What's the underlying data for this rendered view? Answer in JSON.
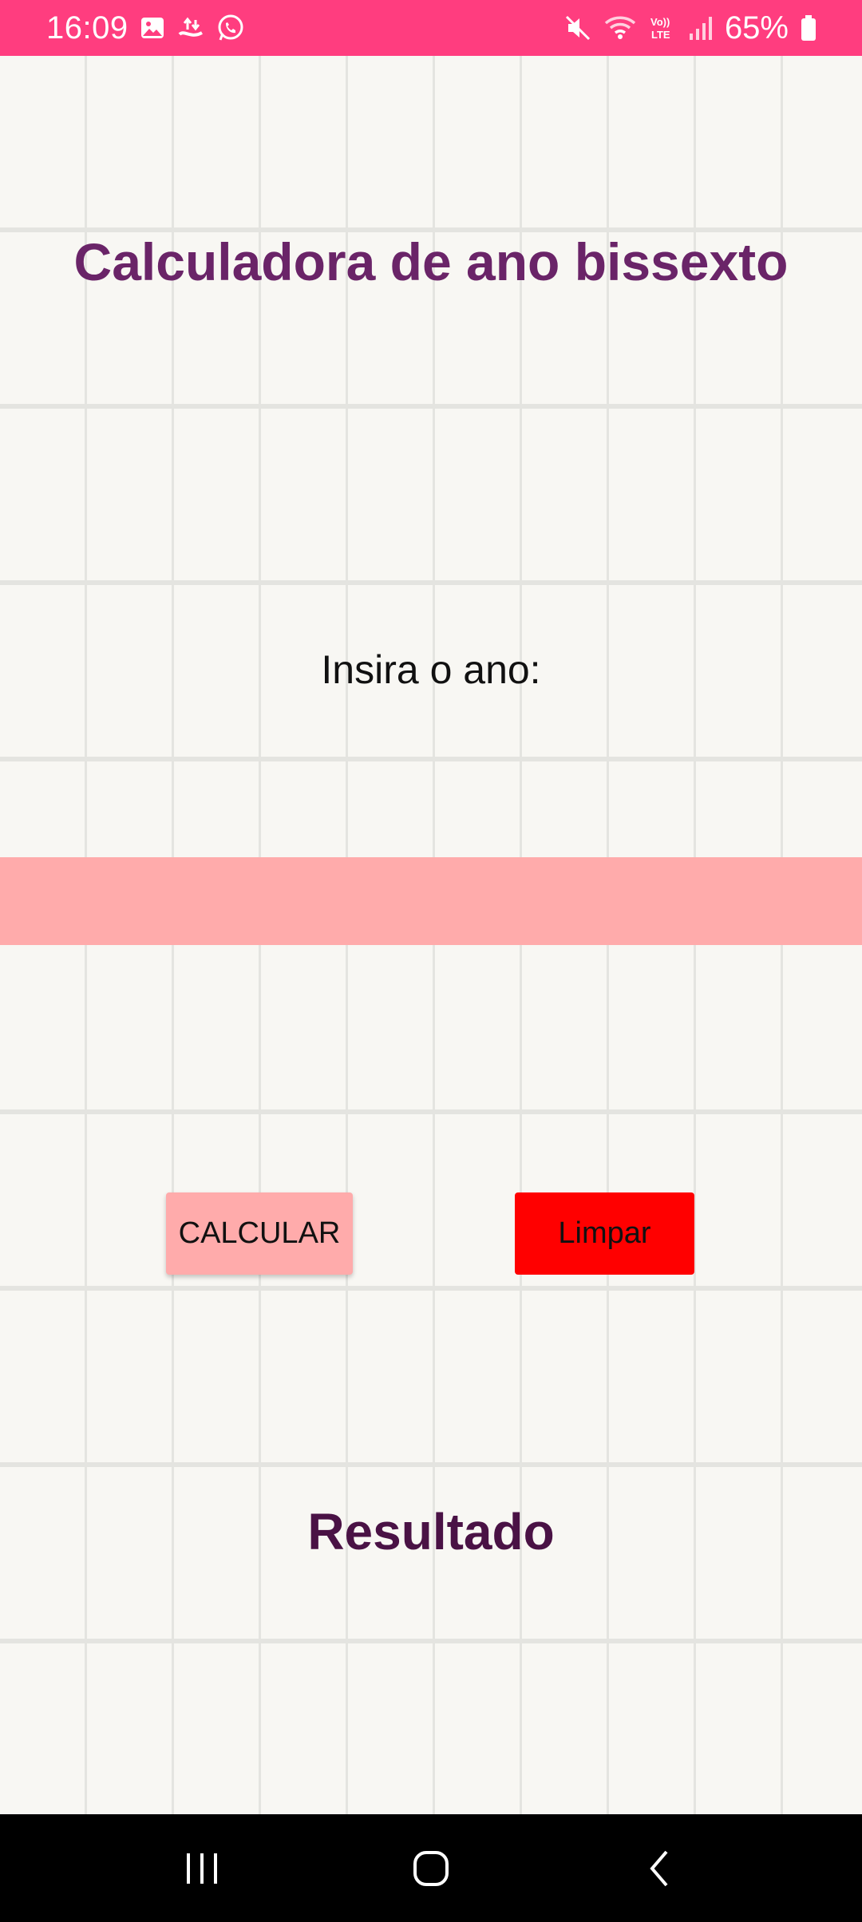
{
  "status_bar": {
    "time": "16:09",
    "battery_percent": "65%",
    "left_icons": [
      "gallery-icon",
      "hotspot-icon",
      "whatsapp-icon"
    ],
    "right_icons": [
      "mute-icon",
      "wifi-icon",
      "volte-icon",
      "signal-icon",
      "battery-icon"
    ],
    "background": "#ff3d7f"
  },
  "app": {
    "title": "Calculadora de ano bissexto",
    "prompt_label": "Insira o ano:",
    "year_input": {
      "value": "",
      "placeholder": ""
    },
    "calculate_label": "CALCULAR",
    "clear_label": "Limpar",
    "result_label": "Resultado"
  },
  "colors": {
    "title": "#6a2468",
    "result": "#4a1245",
    "input_bg": "#ffabab",
    "calculate_bg": "#ffabab",
    "clear_bg": "#ff0000",
    "page_bg": "#f8f7f3"
  },
  "nav_bar": {
    "buttons": [
      "recent-apps-icon",
      "home-icon",
      "back-icon"
    ]
  }
}
